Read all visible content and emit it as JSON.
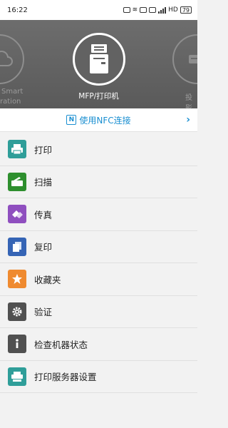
{
  "status_bar": {
    "time": "16:22",
    "network": "HD",
    "battery": "79"
  },
  "carousel": {
    "left_label_line1": "Smart",
    "left_label_line2": "ration",
    "center_label": "MFP/打印机",
    "right_label": "投影"
  },
  "nfc": {
    "logo": "N",
    "label": "使用NFC连接",
    "chevron": "›"
  },
  "menu": {
    "items": [
      {
        "label": "打印",
        "icon": "print-icon",
        "color": "#2f9e99"
      },
      {
        "label": "扫描",
        "icon": "scan-icon",
        "color": "#2e8f2e"
      },
      {
        "label": "传真",
        "icon": "fax-icon",
        "color": "#8f4fbf"
      },
      {
        "label": "复印",
        "icon": "copy-icon",
        "color": "#3564b5"
      },
      {
        "label": "收藏夹",
        "icon": "star-icon",
        "color": "#ef8a2f"
      },
      {
        "label": "验证",
        "icon": "gear-icon",
        "color": "#505050"
      },
      {
        "label": "检查机器状态",
        "icon": "info-icon",
        "color": "#505050"
      },
      {
        "label": "打印服务器设置",
        "icon": "print-server-icon",
        "color": "#2f9e99"
      }
    ]
  }
}
